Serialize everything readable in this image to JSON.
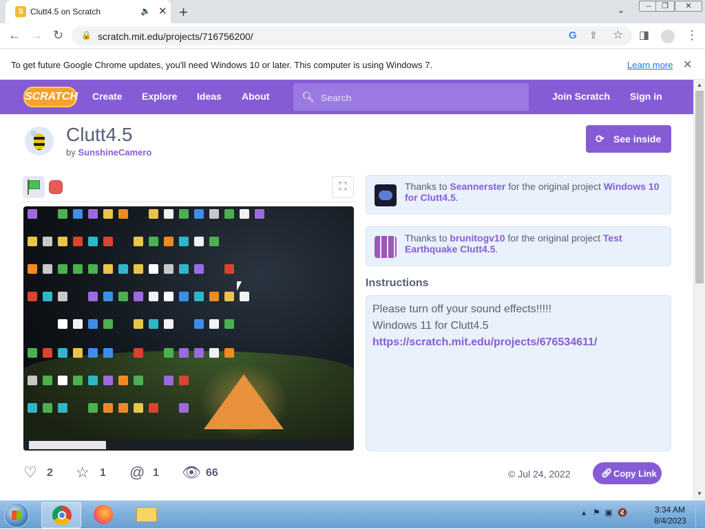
{
  "browser": {
    "tab_title": "Clutt4.5 on Scratch",
    "favicon_letter": "S",
    "url": "scratch.mit.edu/projects/716756200/",
    "infobar_message": "To get future Google Chrome updates, you'll need Windows 10 or later. This computer is using Windows 7.",
    "infobar_link": "Learn more"
  },
  "nav": {
    "logo": "SCRATCH",
    "links": [
      "Create",
      "Explore",
      "Ideas",
      "About"
    ],
    "search_placeholder": "Search",
    "join": "Join Scratch",
    "signin": "Sign in"
  },
  "project": {
    "title": "Clutt4.5",
    "by_prefix": "by",
    "author": "SunshineCamero",
    "see_inside": "See inside"
  },
  "credits": [
    {
      "pre": "Thanks to ",
      "user": "Seannerster",
      "mid": " for the original project ",
      "project": "Windows 10 for Clutt4.5",
      "post": "."
    },
    {
      "pre": "Thanks to ",
      "user": "brunitogv10",
      "mid": " for the original project ",
      "project": "Test Earthquake Clutt4.5",
      "post": "."
    }
  ],
  "instructions": {
    "heading": "Instructions",
    "lines": [
      "Please turn off your sound effects!!!!!",
      "Windows 11 for Clutt4.5",
      "https://scratch.mit.edu/projects/676534611/"
    ]
  },
  "stats": {
    "loves": "2",
    "favorites": "1",
    "remixes": "1",
    "views": "66"
  },
  "shared_date": "Jul 24, 2022",
  "copy_link": "Copy Link",
  "taskbar": {
    "time": "3:34 AM",
    "date": "8/4/2023"
  },
  "colors": {
    "scratch_purple": "#855cd6",
    "credit_bg": "#e9f1fc",
    "text": "#575e75"
  }
}
